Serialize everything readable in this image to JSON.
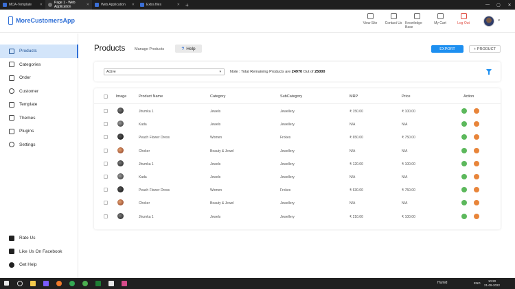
{
  "browser": {
    "tabs": [
      {
        "label": "MCA-Template",
        "active": false
      },
      {
        "label": "Page 1 - Web Application",
        "active": true
      },
      {
        "label": "Web Application",
        "active": false
      },
      {
        "label": "Extra files",
        "active": false
      }
    ],
    "new_tab": "+"
  },
  "header": {
    "app_name": "MoreCustomersApp",
    "nav": [
      {
        "label": "View Site",
        "icon": "view-site-icon"
      },
      {
        "label": "Contact Us",
        "icon": "contact-icon"
      },
      {
        "label": "Knowledge Base",
        "icon": "knowledge-base-icon"
      },
      {
        "label": "My Cart",
        "icon": "cart-icon"
      },
      {
        "label": "Log Out",
        "icon": "logout-icon"
      }
    ]
  },
  "sidebar": {
    "items": [
      {
        "label": "Products",
        "icon": "products-icon",
        "active": true
      },
      {
        "label": "Categories",
        "icon": "categories-icon"
      },
      {
        "label": "Order",
        "icon": "order-icon"
      },
      {
        "label": "Customer",
        "icon": "customer-icon"
      },
      {
        "label": "Template",
        "icon": "template-icon"
      },
      {
        "label": "Themes",
        "icon": "themes-icon"
      },
      {
        "label": "Plugins",
        "icon": "plugins-icon"
      },
      {
        "label": "Settings",
        "icon": "settings-icon"
      }
    ],
    "bottom_items": [
      {
        "label": "Rate Us",
        "icon": "rate-icon"
      },
      {
        "label": "Like Us On Facebook",
        "icon": "thumbs-up-icon"
      },
      {
        "label": "Get Help",
        "icon": "help-chat-icon"
      }
    ]
  },
  "main": {
    "title": "Products",
    "subtitle": "Manage Products",
    "help_label": "Help",
    "help_icon_glyph": "?",
    "export_label": "EXPORT",
    "add_product_label": "+ PRODUCT",
    "filter": {
      "status_value": "Active",
      "note_prefix": "Note : Total Remaining Products are ",
      "remaining": "24970",
      "out_of": " Out of ",
      "total": "25000"
    }
  },
  "table": {
    "headers": [
      "Image",
      "Product Name",
      "Category",
      "SubCategory",
      "MRP",
      "Price",
      "Action"
    ],
    "rows": [
      {
        "name": "Jhumka 1",
        "category": "Jewels",
        "subcategory": "Jewellery",
        "mrp": "₹ 150.00",
        "price": "₹ 100.00",
        "thumb": "jhumka"
      },
      {
        "name": "Kada",
        "category": "Jewels",
        "subcategory": "Jewellery",
        "mrp": "N/A",
        "price": "N/A",
        "thumb": "kada"
      },
      {
        "name": "Peach Flower Dress",
        "category": "Women",
        "subcategory": "Frokes",
        "mrp": "₹ 650.00",
        "price": "₹ 750.00",
        "thumb": "dress"
      },
      {
        "name": "Choker",
        "category": "Beauty & Jewel",
        "subcategory": "Jewellery",
        "mrp": "N/A",
        "price": "N/A",
        "thumb": "choker"
      },
      {
        "name": "Jhumka 1",
        "category": "Jewels",
        "subcategory": "Jewellery",
        "mrp": "₹ 120.00",
        "price": "₹ 100.00",
        "thumb": "jhumka"
      },
      {
        "name": "Kada",
        "category": "Jewels",
        "subcategory": "Jewellery",
        "mrp": "N/A",
        "price": "N/A",
        "thumb": "kada"
      },
      {
        "name": "Peach Flower Dress",
        "category": "Women",
        "subcategory": "Frokes",
        "mrp": "₹ 630.00",
        "price": "₹ 750.00",
        "thumb": "dress"
      },
      {
        "name": "Choker",
        "category": "Beauty & Jewel",
        "subcategory": "Jewellery",
        "mrp": "N/A",
        "price": "N/A",
        "thumb": "choker"
      },
      {
        "name": "Jhumka 1",
        "category": "Jewels",
        "subcategory": "Jewellery",
        "mrp": "₹ 210.00",
        "price": "₹ 100.00",
        "thumb": "jhumka"
      }
    ]
  },
  "taskbar": {
    "weather": "Humid",
    "lang": "ENG",
    "time": "10:20",
    "date": "21-09-2022"
  },
  "colors": {
    "accent": "#1d8ff0",
    "brand": "#2f6fd6",
    "logout": "#e0483e",
    "active_bg": "#d3e5fa",
    "action_view": "#5cb85c",
    "action_delete": "#e8853a"
  }
}
